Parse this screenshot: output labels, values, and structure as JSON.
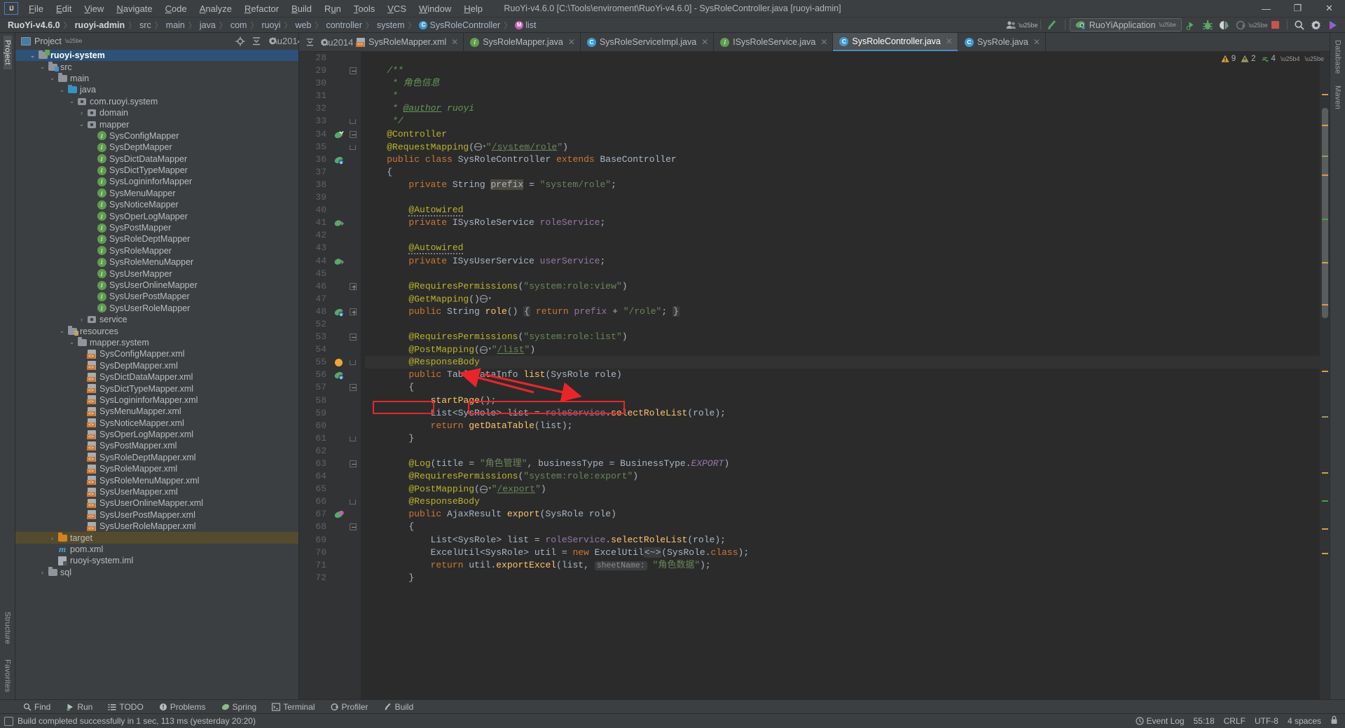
{
  "window": {
    "title": "RuoYi-v4.6.0 [C:\\Tools\\enviroment\\RuoYi-v4.6.0] - SysRoleController.java [ruoyi-admin]",
    "minimize": "—",
    "maximize": "❐",
    "close": "✕"
  },
  "menu": [
    "File",
    "Edit",
    "View",
    "Navigate",
    "Code",
    "Analyze",
    "Refactor",
    "Build",
    "Run",
    "Tools",
    "VCS",
    "Window",
    "Help"
  ],
  "breadcrumbs": [
    {
      "label": "RuoYi-v4.6.0",
      "bold": true,
      "icon": ""
    },
    {
      "label": "ruoyi-admin",
      "bold": true,
      "icon": ""
    },
    {
      "label": "src",
      "bold": false,
      "icon": ""
    },
    {
      "label": "main",
      "bold": false,
      "icon": ""
    },
    {
      "label": "java",
      "bold": false,
      "icon": ""
    },
    {
      "label": "com",
      "bold": false,
      "icon": ""
    },
    {
      "label": "ruoyi",
      "bold": false,
      "icon": ""
    },
    {
      "label": "web",
      "bold": false,
      "icon": ""
    },
    {
      "label": "controller",
      "bold": false,
      "icon": ""
    },
    {
      "label": "system",
      "bold": false,
      "icon": ""
    },
    {
      "label": "SysRoleController",
      "bold": false,
      "icon": "c"
    },
    {
      "label": "list",
      "bold": false,
      "icon": "m"
    }
  ],
  "toolbar": {
    "run_config": "RuoYiApplication",
    "icons": [
      "avatar-icon",
      "update-project-icon",
      "run-icon",
      "debug-icon",
      "run-coverage-icon",
      "profile-icon",
      "stop-icon",
      "search-everywhere-icon",
      "settings-icon"
    ]
  },
  "sidebar_left": {
    "top": "Project",
    "bottom": [
      "Structure",
      "Favorites"
    ]
  },
  "sidebar_right": [
    "Database",
    "Maven"
  ],
  "project_panel": {
    "title": "Project",
    "buttons": [
      "locate-icon",
      "collapse-all-icon",
      "settings-icon",
      "hide-icon"
    ],
    "tree": [
      {
        "depth": 1,
        "arrow": "down",
        "icon": "module",
        "label": "ruoyi-system",
        "state": "selected"
      },
      {
        "depth": 2,
        "arrow": "down",
        "icon": "folder-src",
        "label": "src",
        "state": ""
      },
      {
        "depth": 3,
        "arrow": "down",
        "icon": "folder",
        "label": "main",
        "state": ""
      },
      {
        "depth": 4,
        "arrow": "down",
        "icon": "folder-blue",
        "label": "java",
        "state": ""
      },
      {
        "depth": 5,
        "arrow": "down",
        "icon": "package",
        "label": "com.ruoyi.system",
        "state": ""
      },
      {
        "depth": 6,
        "arrow": "right",
        "icon": "package",
        "label": "domain",
        "state": ""
      },
      {
        "depth": 6,
        "arrow": "down",
        "icon": "package",
        "label": "mapper",
        "state": ""
      },
      {
        "depth": 7,
        "arrow": "",
        "icon": "interface",
        "label": "SysConfigMapper",
        "state": ""
      },
      {
        "depth": 7,
        "arrow": "",
        "icon": "interface",
        "label": "SysDeptMapper",
        "state": ""
      },
      {
        "depth": 7,
        "arrow": "",
        "icon": "interface",
        "label": "SysDictDataMapper",
        "state": ""
      },
      {
        "depth": 7,
        "arrow": "",
        "icon": "interface",
        "label": "SysDictTypeMapper",
        "state": ""
      },
      {
        "depth": 7,
        "arrow": "",
        "icon": "interface",
        "label": "SysLogininforMapper",
        "state": ""
      },
      {
        "depth": 7,
        "arrow": "",
        "icon": "interface",
        "label": "SysMenuMapper",
        "state": ""
      },
      {
        "depth": 7,
        "arrow": "",
        "icon": "interface",
        "label": "SysNoticeMapper",
        "state": ""
      },
      {
        "depth": 7,
        "arrow": "",
        "icon": "interface",
        "label": "SysOperLogMapper",
        "state": ""
      },
      {
        "depth": 7,
        "arrow": "",
        "icon": "interface",
        "label": "SysPostMapper",
        "state": ""
      },
      {
        "depth": 7,
        "arrow": "",
        "icon": "interface",
        "label": "SysRoleDeptMapper",
        "state": ""
      },
      {
        "depth": 7,
        "arrow": "",
        "icon": "interface",
        "label": "SysRoleMapper",
        "state": ""
      },
      {
        "depth": 7,
        "arrow": "",
        "icon": "interface",
        "label": "SysRoleMenuMapper",
        "state": ""
      },
      {
        "depth": 7,
        "arrow": "",
        "icon": "interface",
        "label": "SysUserMapper",
        "state": ""
      },
      {
        "depth": 7,
        "arrow": "",
        "icon": "interface",
        "label": "SysUserOnlineMapper",
        "state": ""
      },
      {
        "depth": 7,
        "arrow": "",
        "icon": "interface",
        "label": "SysUserPostMapper",
        "state": ""
      },
      {
        "depth": 7,
        "arrow": "",
        "icon": "interface",
        "label": "SysUserRoleMapper",
        "state": ""
      },
      {
        "depth": 6,
        "arrow": "right",
        "icon": "package",
        "label": "service",
        "state": ""
      },
      {
        "depth": 4,
        "arrow": "down",
        "icon": "folder-res",
        "label": "resources",
        "state": ""
      },
      {
        "depth": 5,
        "arrow": "down",
        "icon": "folder",
        "label": "mapper.system",
        "state": ""
      },
      {
        "depth": 6,
        "arrow": "",
        "icon": "xml",
        "label": "SysConfigMapper.xml",
        "state": ""
      },
      {
        "depth": 6,
        "arrow": "",
        "icon": "xml",
        "label": "SysDeptMapper.xml",
        "state": ""
      },
      {
        "depth": 6,
        "arrow": "",
        "icon": "xml",
        "label": "SysDictDataMapper.xml",
        "state": ""
      },
      {
        "depth": 6,
        "arrow": "",
        "icon": "xml",
        "label": "SysDictTypeMapper.xml",
        "state": ""
      },
      {
        "depth": 6,
        "arrow": "",
        "icon": "xml",
        "label": "SysLogininforMapper.xml",
        "state": ""
      },
      {
        "depth": 6,
        "arrow": "",
        "icon": "xml",
        "label": "SysMenuMapper.xml",
        "state": ""
      },
      {
        "depth": 6,
        "arrow": "",
        "icon": "xml",
        "label": "SysNoticeMapper.xml",
        "state": ""
      },
      {
        "depth": 6,
        "arrow": "",
        "icon": "xml",
        "label": "SysOperLogMapper.xml",
        "state": ""
      },
      {
        "depth": 6,
        "arrow": "",
        "icon": "xml",
        "label": "SysPostMapper.xml",
        "state": ""
      },
      {
        "depth": 6,
        "arrow": "",
        "icon": "xml",
        "label": "SysRoleDeptMapper.xml",
        "state": ""
      },
      {
        "depth": 6,
        "arrow": "",
        "icon": "xml",
        "label": "SysRoleMapper.xml",
        "state": ""
      },
      {
        "depth": 6,
        "arrow": "",
        "icon": "xml",
        "label": "SysRoleMenuMapper.xml",
        "state": ""
      },
      {
        "depth": 6,
        "arrow": "",
        "icon": "xml",
        "label": "SysUserMapper.xml",
        "state": ""
      },
      {
        "depth": 6,
        "arrow": "",
        "icon": "xml",
        "label": "SysUserOnlineMapper.xml",
        "state": ""
      },
      {
        "depth": 6,
        "arrow": "",
        "icon": "xml",
        "label": "SysUserPostMapper.xml",
        "state": ""
      },
      {
        "depth": 6,
        "arrow": "",
        "icon": "xml",
        "label": "SysUserRoleMapper.xml",
        "state": ""
      },
      {
        "depth": 3,
        "arrow": "right",
        "icon": "folder-orange",
        "label": "target",
        "state": "highlight"
      },
      {
        "depth": 3,
        "arrow": "",
        "icon": "maven",
        "label": "pom.xml",
        "state": ""
      },
      {
        "depth": 3,
        "arrow": "",
        "icon": "iml",
        "label": "ruoyi-system.iml",
        "state": ""
      },
      {
        "depth": 2,
        "arrow": "right",
        "icon": "folder",
        "label": "sql",
        "state": ""
      }
    ]
  },
  "editor": {
    "tabs": [
      {
        "label": "SysRoleMapper.xml",
        "icon": "xml",
        "active": false
      },
      {
        "label": "SysRoleMapper.java",
        "icon": "interface",
        "active": false
      },
      {
        "label": "SysRoleServiceImpl.java",
        "icon": "class",
        "active": false
      },
      {
        "label": "ISysRoleService.java",
        "icon": "interface",
        "active": false
      },
      {
        "label": "SysRoleController.java",
        "icon": "class",
        "active": true
      },
      {
        "label": "SysRole.java",
        "icon": "class",
        "active": false
      }
    ],
    "inspection": {
      "warnings": "9",
      "weak_warnings": "2",
      "typos": "4"
    },
    "lines": [
      {
        "no": "28",
        "gutter": "",
        "fold": "",
        "html": ""
      },
      {
        "no": "29",
        "gutter": "",
        "fold": "minus",
        "html": "    <span class='doc'>/**</span>"
      },
      {
        "no": "30",
        "gutter": "",
        "fold": "",
        "html": "     <span class='doc'>* 角色信息</span>"
      },
      {
        "no": "31",
        "gutter": "",
        "fold": "",
        "html": "     <span class='doc'>*</span>"
      },
      {
        "no": "32",
        "gutter": "",
        "fold": "",
        "html": "     <span class='doc'>* <span class='tag'>@author</span> ruoyi</span>"
      },
      {
        "no": "33",
        "gutter": "",
        "fold": "end",
        "html": "     <span class='doc'>*/</span>"
      },
      {
        "no": "34",
        "gutter": "bean",
        "fold": "minus",
        "html": "    <span class='ann'>@Controller</span>"
      },
      {
        "no": "35",
        "gutter": "",
        "fold": "end",
        "html": "    <span class='ann'>@RequestMapping</span>(<span class='webicon'><span class='globe'></span><span class='chev'>▾</span></span><span class='str'>\"</span><span class='lnk'>/system/role</span><span class='str'>\"</span>)"
      },
      {
        "no": "36",
        "gutter": "bean2",
        "fold": "",
        "html": "    <span class='kw'>public class</span> SysRoleController <span class='kw'>extends</span> BaseController"
      },
      {
        "no": "37",
        "gutter": "",
        "fold": "",
        "html": "    {"
      },
      {
        "no": "38",
        "gutter": "",
        "fold": "",
        "html": "        <span class='kw'>private</span> String <span class='hlbox'>prefix</span> = <span class='str'>\"system/role\"</span>;"
      },
      {
        "no": "39",
        "gutter": "",
        "fold": "",
        "html": ""
      },
      {
        "no": "40",
        "gutter": "",
        "fold": "",
        "html": "        <span class='ann squig'>@Autowired</span>"
      },
      {
        "no": "41",
        "gutter": "impl",
        "fold": "",
        "html": "        <span class='kw'>private</span> ISysRoleService <span class='fld'>roleService</span>;"
      },
      {
        "no": "42",
        "gutter": "",
        "fold": "",
        "html": ""
      },
      {
        "no": "43",
        "gutter": "",
        "fold": "",
        "html": "        <span class='ann squig'>@Autowired</span>"
      },
      {
        "no": "44",
        "gutter": "impl",
        "fold": "",
        "html": "        <span class='kw'>private</span> ISysUserService <span class='fld'>userService</span>;"
      },
      {
        "no": "45",
        "gutter": "",
        "fold": "",
        "html": ""
      },
      {
        "no": "46",
        "gutter": "",
        "fold": "plus",
        "html": "        <span class='ann'>@RequiresPermissions</span>(<span class='str'>\"system:role:view\"</span>)"
      },
      {
        "no": "47",
        "gutter": "",
        "fold": "",
        "html": "        <span class='ann'>@GetMapping</span>()<span class='webicon'><span class='globe'></span><span class='chev'>▾</span></span>"
      },
      {
        "no": "48",
        "gutter": "bean2",
        "fold": "plus",
        "html": "        <span class='kw'>public</span> String <span class='mth'>role</span>() <span class='fold-ph'>{</span> <span class='kw'>return</span> <span class='fld'>prefix</span> + <span class='str'>\"/role\"</span>; <span class='fold-ph'>}</span>"
      },
      {
        "no": "52",
        "gutter": "",
        "fold": "",
        "html": ""
      },
      {
        "no": "53",
        "gutter": "",
        "fold": "minus",
        "html": "        <span class='ann'>@RequiresPermissions</span>(<span class='str'>\"system:role:list\"</span>)"
      },
      {
        "no": "54",
        "gutter": "",
        "fold": "",
        "html": "        <span class='ann'>@PostMapping</span>(<span class='webicon'><span class='globe'></span><span class='chev'>▾</span></span><span class='str'>\"</span><span class='lnk'>/list</span><span class='str'>\"</span>)"
      },
      {
        "no": "55",
        "gutter": "bulb",
        "fold": "end",
        "html": "        <span class='ann'>@ResponseBody</span>",
        "current": true
      },
      {
        "no": "56",
        "gutter": "bean2",
        "fold": "",
        "html": "        <span class='kw'>public</span> TableDataInfo <span class='mth'>list</span>(SysRole role)"
      },
      {
        "no": "57",
        "gutter": "",
        "fold": "minus",
        "html": "        {"
      },
      {
        "no": "58",
        "gutter": "",
        "fold": "",
        "html": "            <span class='mth'>startPage</span>();"
      },
      {
        "no": "59",
        "gutter": "",
        "fold": "",
        "html": "            List&lt;SysRole&gt; list = <span class='fld'>roleService</span>.<span class='mth'>selectRoleList</span>(role);"
      },
      {
        "no": "60",
        "gutter": "",
        "fold": "",
        "html": "            <span class='kw'>return</span> <span class='mth'>getDataTable</span>(list);"
      },
      {
        "no": "61",
        "gutter": "",
        "fold": "end",
        "html": "        }"
      },
      {
        "no": "62",
        "gutter": "",
        "fold": "",
        "html": ""
      },
      {
        "no": "63",
        "gutter": "",
        "fold": "minus",
        "html": "        <span class='ann'>@Log</span>(title = <span class='str'>\"角色管理\"</span>, businessType = BusinessType.<span class='stat'>EXPORT</span>)"
      },
      {
        "no": "64",
        "gutter": "",
        "fold": "",
        "html": "        <span class='ann'>@RequiresPermissions</span>(<span class='str'>\"system:role:export\"</span>)"
      },
      {
        "no": "65",
        "gutter": "",
        "fold": "",
        "html": "        <span class='ann'>@PostMapping</span>(<span class='webicon'><span class='globe'></span><span class='chev'>▾</span></span><span class='str'>\"</span><span class='lnk'>/export</span><span class='str'>\"</span>)"
      },
      {
        "no": "66",
        "gutter": "",
        "fold": "end",
        "html": "        <span class='ann'>@ResponseBody</span>"
      },
      {
        "no": "67",
        "gutter": "bean3",
        "fold": "",
        "html": "        <span class='kw'>public</span> AjaxResult <span class='mth'>export</span>(SysRole role)"
      },
      {
        "no": "68",
        "gutter": "",
        "fold": "minus",
        "html": "        {"
      },
      {
        "no": "69",
        "gutter": "",
        "fold": "",
        "html": "            List&lt;SysRole&gt; list = <span class='fld'>roleService</span>.<span class='mth'>selectRoleList</span>(role);"
      },
      {
        "no": "70",
        "gutter": "",
        "fold": "",
        "html": "            ExcelUtil&lt;SysRole&gt; util = <span class='kw'>new</span> ExcelUtil<span class='fold-ph'>&lt;~&gt;</span>(SysRole.<span class='kw'>class</span>);"
      },
      {
        "no": "71",
        "gutter": "",
        "fold": "",
        "html": "            <span class='kw'>return</span> util.<span class='mth'>exportExcel</span>(list, <span class='param-hint'>sheetName:</span> <span class='str'>\"角色数据\"</span>);"
      },
      {
        "no": "72",
        "gutter": "",
        "fold": "",
        "html": "        }"
      }
    ]
  },
  "annotations": {
    "box1_label": "List<SysRole>",
    "box2_label": "roleService.selectRoleList(role);",
    "arrow_color": "#e8262a"
  },
  "bottom_tools": [
    {
      "label": "Find",
      "icon": "search-icon"
    },
    {
      "label": "Run",
      "icon": "run-icon"
    },
    {
      "label": "TODO",
      "icon": "todo-icon"
    },
    {
      "label": "Problems",
      "icon": "problems-icon"
    },
    {
      "label": "Spring",
      "icon": "spring-icon"
    },
    {
      "label": "Terminal",
      "icon": "terminal-icon"
    },
    {
      "label": "Profiler",
      "icon": "profiler-icon"
    },
    {
      "label": "Build",
      "icon": "build-icon"
    }
  ],
  "statusbar": {
    "message": "Build completed successfully in 1 sec, 113 ms (yesterday 20:20)",
    "caret": "55:18",
    "line_sep": "CRLF",
    "encoding": "UTF-8",
    "indent": "4 spaces",
    "event_log": "Event Log",
    "lock": "lock-icon"
  }
}
